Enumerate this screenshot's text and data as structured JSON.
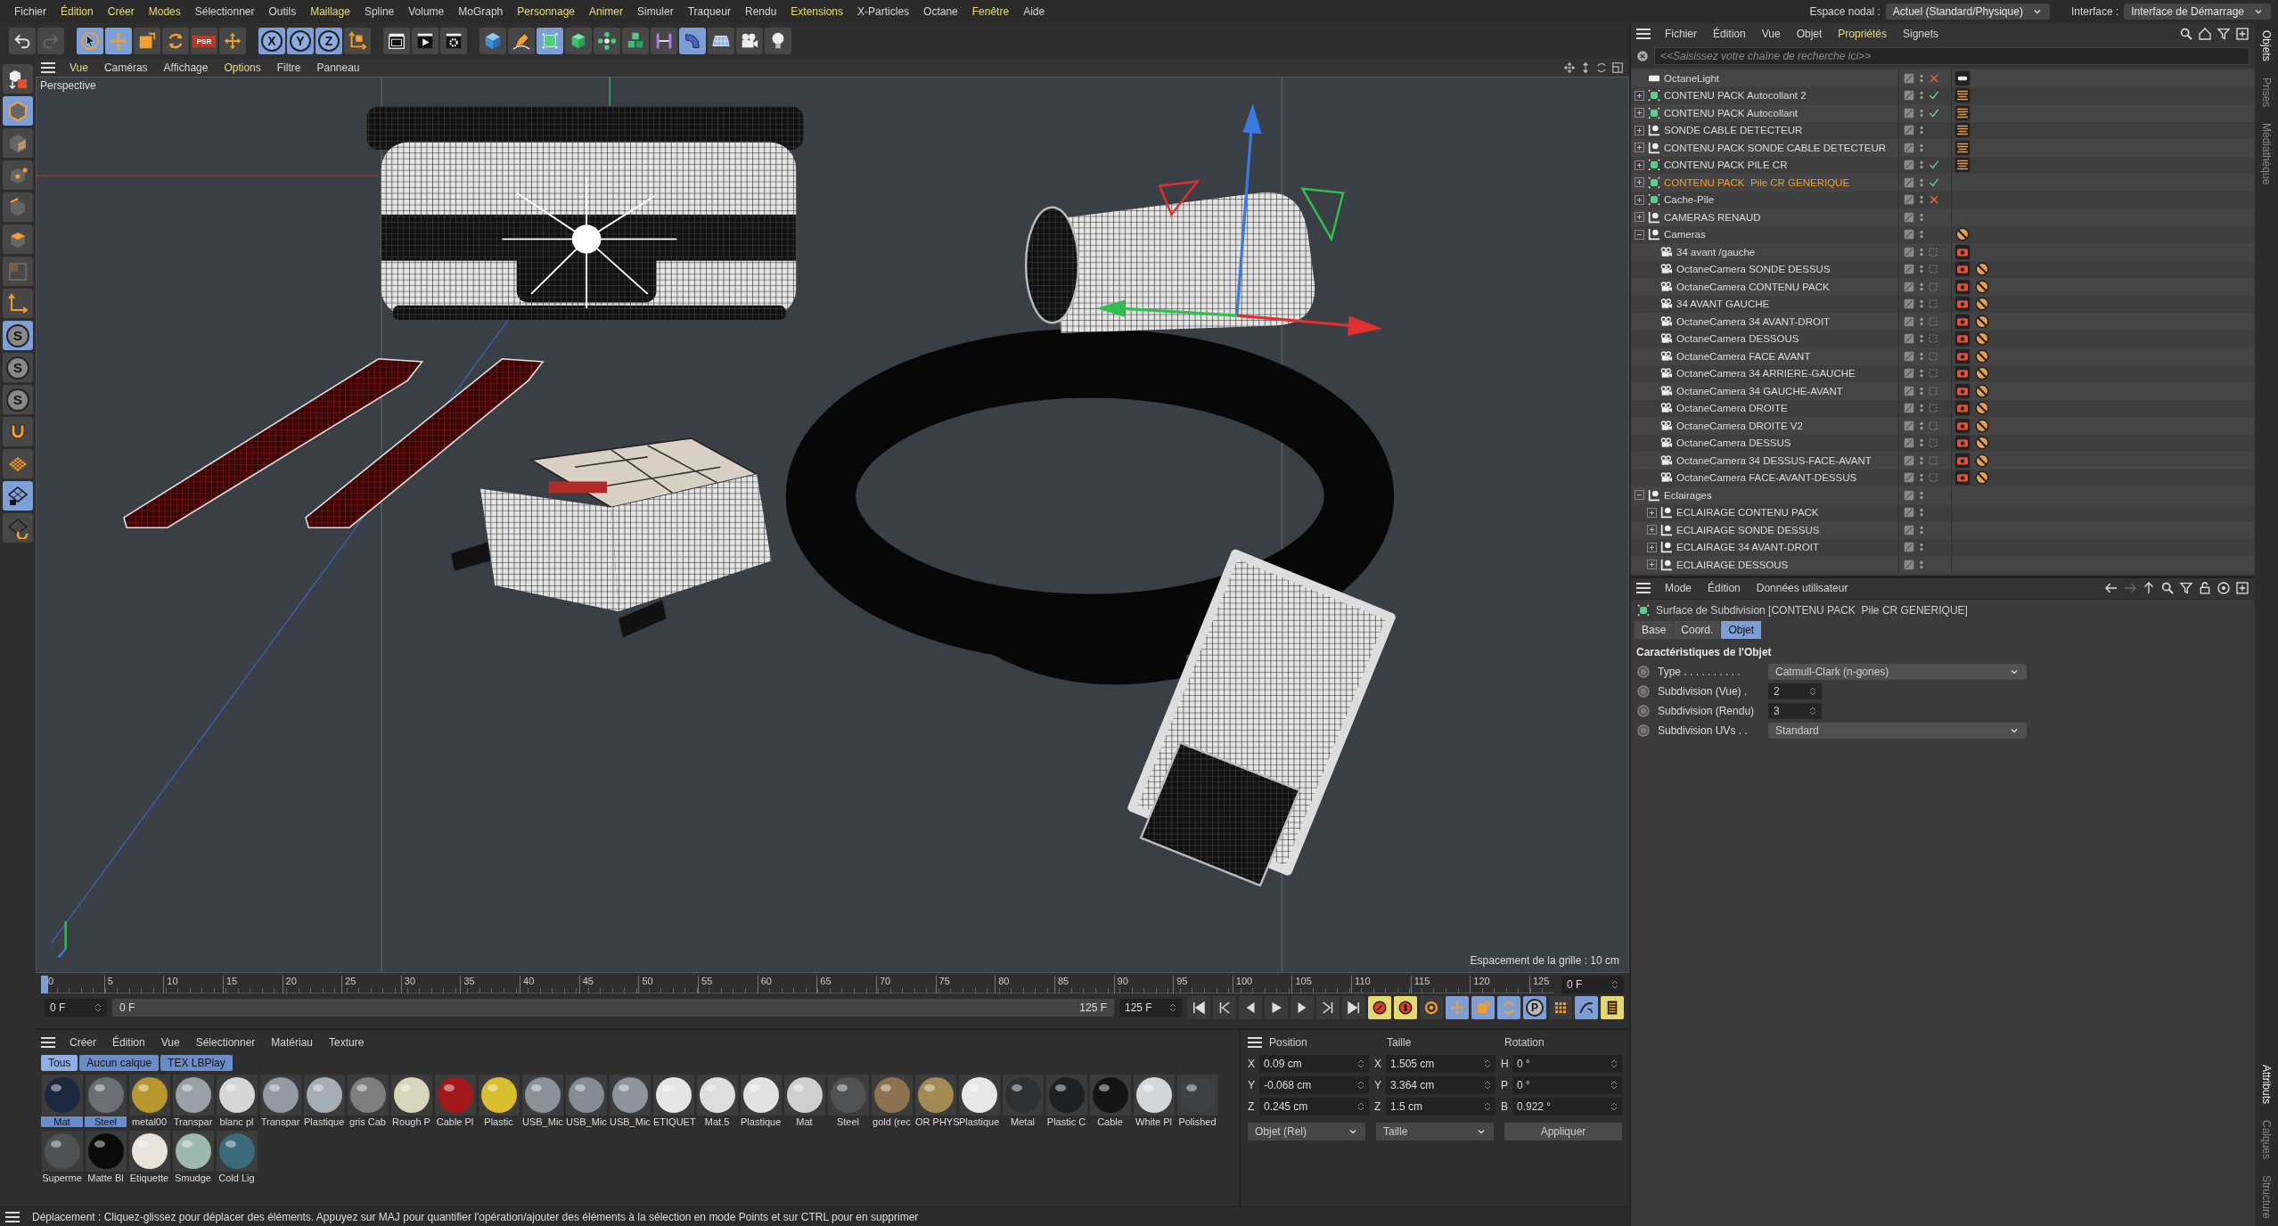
{
  "menubar": {
    "items": [
      {
        "label": "Fichier",
        "highlighted": false
      },
      {
        "label": "Édition",
        "highlighted": true
      },
      {
        "label": "Créer",
        "highlighted": true
      },
      {
        "label": "Modes",
        "highlighted": true
      },
      {
        "label": "Sélectionner",
        "highlighted": false
      },
      {
        "label": "Outils",
        "highlighted": false
      },
      {
        "label": "Maillage",
        "highlighted": true
      },
      {
        "label": "Spline",
        "highlighted": false
      },
      {
        "label": "Volume",
        "highlighted": false
      },
      {
        "label": "MoGraph",
        "highlighted": false
      },
      {
        "label": "Personnage",
        "highlighted": true
      },
      {
        "label": "Animer",
        "highlighted": true
      },
      {
        "label": "Simuler",
        "highlighted": false
      },
      {
        "label": "Traqueur",
        "highlighted": false
      },
      {
        "label": "Rendu",
        "highlighted": false
      },
      {
        "label": "Extensions",
        "highlighted": true
      },
      {
        "label": "X-Particles",
        "highlighted": false
      },
      {
        "label": "Octane",
        "highlighted": false
      },
      {
        "label": "Fenêtre",
        "highlighted": true
      },
      {
        "label": "Aide",
        "highlighted": false
      }
    ],
    "selectors": [
      {
        "label": "Espace nodal :",
        "value": "Actuel (Standard/Physique)"
      },
      {
        "label": "Interface :",
        "value": "Interface de Démarrage"
      }
    ]
  },
  "toolbar": {
    "groups": [
      {
        "items": [
          {
            "kind": "undo",
            "selected": false
          },
          {
            "kind": "redo",
            "selected": false
          }
        ]
      },
      {
        "items": [
          {
            "kind": "cursor",
            "selected": true
          },
          {
            "kind": "move",
            "selected": true
          },
          {
            "kind": "scale",
            "selected": false
          },
          {
            "kind": "rotate",
            "selected": false
          },
          {
            "kind": "psr",
            "label": "PSR",
            "selected": false
          },
          {
            "kind": "move",
            "selected": false
          }
        ]
      },
      {
        "items": [
          {
            "kind": "axis",
            "label": "X",
            "selected": true
          },
          {
            "kind": "axis",
            "label": "Y",
            "selected": true
          },
          {
            "kind": "axis",
            "label": "Z",
            "selected": true
          },
          {
            "kind": "coord",
            "selected": false
          }
        ]
      },
      {
        "items": [
          {
            "kind": "render-view",
            "selected": false
          },
          {
            "kind": "render",
            "selected": false
          },
          {
            "kind": "render-settings",
            "selected": false
          }
        ]
      },
      {
        "items": [
          {
            "kind": "cube",
            "selected": false
          },
          {
            "kind": "pen",
            "selected": false
          },
          {
            "kind": "subdivision",
            "selected": true
          },
          {
            "kind": "extrude",
            "selected": false
          },
          {
            "kind": "cloner",
            "selected": false
          },
          {
            "kind": "array",
            "selected": false
          },
          {
            "kind": "deformer",
            "selected": false
          },
          {
            "kind": "bend",
            "selected": true
          },
          {
            "kind": "floor",
            "selected": false
          },
          {
            "kind": "camera",
            "selected": false
          },
          {
            "kind": "light",
            "selected": false
          }
        ]
      }
    ]
  },
  "left_toolbar": [
    {
      "kind": "model",
      "selected": false
    },
    {
      "kind": "object",
      "selected": true
    },
    {
      "kind": "texture",
      "selected": false
    },
    {
      "kind": "points",
      "selected": false
    },
    {
      "kind": "edges",
      "selected": false
    },
    {
      "kind": "polygons",
      "selected": false
    },
    {
      "kind": "uv",
      "selected": false
    },
    {
      "kind": "axis",
      "selected": false
    },
    {
      "kind": "snap",
      "label": "S",
      "selected": true
    },
    {
      "kind": "snap",
      "label": "S",
      "selected": false
    },
    {
      "kind": "snap",
      "label": "S",
      "selected": false
    },
    {
      "kind": "magnet",
      "selected": false
    },
    {
      "kind": "workplane",
      "selected": false
    },
    {
      "kind": "workplane-lock",
      "selected": true
    },
    {
      "kind": "workplane-rotate",
      "selected": false
    }
  ],
  "viewport": {
    "menu": [
      {
        "label": "Vue",
        "highlighted": true
      },
      {
        "label": "Caméras",
        "highlighted": false
      },
      {
        "label": "Affichage",
        "highlighted": false
      },
      {
        "label": "Options",
        "highlighted": true
      },
      {
        "label": "Filtre",
        "highlighted": false
      },
      {
        "label": "Panneau",
        "highlighted": false
      }
    ],
    "camera_label": "Perspective",
    "grid_spacing": "Espacement de la grille : 10 cm"
  },
  "timeline": {
    "ticks": [
      "0",
      "5",
      "10",
      "15",
      "20",
      "25",
      "30",
      "35",
      "40",
      "45",
      "50",
      "55",
      "60",
      "65",
      "70",
      "75",
      "80",
      "85",
      "90",
      "95",
      "100",
      "105",
      "110",
      "115",
      "120",
      "125"
    ],
    "playhead": {
      "level": 0
    },
    "frame_field": "0 F",
    "start_field": "0 F",
    "range": {
      "start": "0 F",
      "end": "125 F",
      "level": 1
    },
    "end_field": "125 F",
    "param_key_label": "P"
  },
  "materials": {
    "menu": [
      "Créer",
      "Édition",
      "Vue",
      "Sélectionner",
      "Matériau",
      "Texture"
    ],
    "filters": [
      {
        "label": "Tous",
        "selected": true
      },
      {
        "label": "Aucun calque",
        "selected": false
      },
      {
        "label": "TEX LBPlay",
        "selected": false
      }
    ],
    "items": [
      {
        "label": "Mat",
        "color": "#1c2740",
        "selected": true
      },
      {
        "label": "Steel",
        "color": "#6b6e72",
        "selected": true
      },
      {
        "label": "metal00",
        "color": "#b8982e",
        "selected": false
      },
      {
        "label": "Transpar",
        "color": "#9aa0a8",
        "selected": false
      },
      {
        "label": "blanc pl",
        "color": "#d6d6d6",
        "selected": false
      },
      {
        "label": "Transpar",
        "color": "#939aa3",
        "selected": false
      },
      {
        "label": "Plastique",
        "color": "#a4acb4",
        "selected": false
      },
      {
        "label": "gris Cab",
        "color": "#7e7e7e",
        "selected": false
      },
      {
        "label": "Rough P",
        "color": "#d9d6bd",
        "selected": false
      },
      {
        "label": "Cable Pl",
        "color": "#a3181a",
        "selected": false
      },
      {
        "label": "Plastic",
        "color": "#d9be2e",
        "selected": false
      },
      {
        "label": "USB_Mic",
        "color": "#8b9199",
        "selected": false
      },
      {
        "label": "USB_Mic",
        "color": "#868c94",
        "selected": false
      },
      {
        "label": "USB_Mic",
        "color": "#8f959d",
        "selected": false
      },
      {
        "label": "ETIQUET",
        "color": "#e6e6e6",
        "selected": false
      },
      {
        "label": "Mat.5",
        "color": "#dedede",
        "selected": false
      },
      {
        "label": "Plastique",
        "color": "#e2e2e2",
        "selected": false
      },
      {
        "label": "Mat",
        "color": "#cfcfcf",
        "selected": false
      },
      {
        "label": "Steel",
        "color": "#505254",
        "selected": false
      },
      {
        "label": "gold (rec",
        "color": "#8c7250",
        "selected": false
      },
      {
        "label": "OR PHYS",
        "color": "#a38a52",
        "selected": false
      },
      {
        "label": "Plastique",
        "color": "#e8e8e8",
        "selected": false
      },
      {
        "label": "Metal",
        "color": "#2f3032",
        "selected": false
      },
      {
        "label": "Plastic C",
        "color": "#1f2022",
        "selected": false
      },
      {
        "label": "Cable",
        "color": "#141414",
        "selected": false
      },
      {
        "label": "White Pl",
        "color": "#d4d6d8",
        "selected": false
      },
      {
        "label": "Polished",
        "color": "#3e4042",
        "selected": false
      },
      {
        "label": "Superme",
        "color": "#4e5052",
        "selected": false
      },
      {
        "label": "Matte Bl",
        "color": "#0b0b0b",
        "selected": false
      },
      {
        "label": "Etiquette",
        "color": "#e8e3da",
        "selected": false
      },
      {
        "label": "Smudge",
        "color": "#9fb8b0",
        "selected": false
      },
      {
        "label": "Cold Lig",
        "color": "#3b6a7a",
        "selected": false
      }
    ]
  },
  "coordinates": {
    "headers": [
      "Position",
      "Taille",
      "Rotation"
    ],
    "rows": [
      {
        "cells": [
          {
            "axis": "X",
            "value": "0.09 cm"
          },
          {
            "axis": "X",
            "value": "1.505 cm"
          },
          {
            "axis": "H",
            "value": "0 °"
          }
        ]
      },
      {
        "cells": [
          {
            "axis": "Y",
            "value": "-0.068 cm"
          },
          {
            "axis": "Y",
            "value": "3.364 cm"
          },
          {
            "axis": "P",
            "value": "0 °"
          }
        ]
      },
      {
        "cells": [
          {
            "axis": "Z",
            "value": "0.245 cm"
          },
          {
            "axis": "Z",
            "value": "1.5 cm"
          },
          {
            "axis": "B",
            "value": "0.922 °"
          }
        ]
      }
    ],
    "dropdowns": [
      "Objet (Rel)",
      "Taille"
    ],
    "apply_button": "Appliquer"
  },
  "status_bar": "Déplacement : Cliquez-glissez pour déplacer des éléments. Appuyez sur MAJ pour quantifier l'opération/ajouter des éléments à la sélection en mode Points et sur CTRL pour en supprimer",
  "object_manager": {
    "menu": [
      {
        "label": "Fichier",
        "highlighted": false
      },
      {
        "label": "Édition",
        "highlighted": false
      },
      {
        "label": "Vue",
        "highlighted": false
      },
      {
        "label": "Objet",
        "highlighted": false
      },
      {
        "label": "Propriétés",
        "highlighted": true
      },
      {
        "label": "Signets",
        "highlighted": false
      }
    ],
    "search_placeholder": "<<Saisissez votre chaîne de recherche ici>>",
    "objects": [
      {
        "name": "OctaneLight",
        "kind": "light",
        "enabled": false,
        "tags": [
          {
            "kind": "light"
          }
        ],
        "selected": false
      },
      {
        "name": "CONTENU PACK Autocollant 2",
        "kind": "subdivision",
        "expanded": false,
        "enabled": true,
        "tags": [
          {
            "kind": "clapper"
          }
        ],
        "selected": false
      },
      {
        "name": "CONTENU PACK Autocollant",
        "kind": "subdivision",
        "expanded": false,
        "enabled": true,
        "tags": [
          {
            "kind": "clapper"
          }
        ],
        "selected": false
      },
      {
        "name": "SONDE CABLE DETECTEUR",
        "kind": "null",
        "expanded": false,
        "tags": [
          {
            "kind": "clapper"
          }
        ],
        "selected": false
      },
      {
        "name": "CONTENU PACK SONDE CABLE DETECTEUR",
        "kind": "null",
        "expanded": false,
        "tags": [
          {
            "kind": "clapper"
          }
        ],
        "selected": false
      },
      {
        "name": "CONTENU PACK PILE CR",
        "kind": "subdivision",
        "expanded": false,
        "enabled": true,
        "tags": [
          {
            "kind": "clapper"
          }
        ],
        "selected": false
      },
      {
        "name": "CONTENU PACK  Pile CR GENERIQUE",
        "kind": "subdivision",
        "expanded": false,
        "enabled": true,
        "selected": true
      },
      {
        "name": "Cache-Pile",
        "kind": "subdivision",
        "expanded": false,
        "enabled": false,
        "selected": false
      },
      {
        "name": "CAMERAS RENAUD",
        "kind": "null",
        "expanded": false,
        "selected": false
      },
      {
        "name": "Cameras",
        "kind": "null",
        "expanded": true,
        "tags": [
          {
            "kind": "no-entry"
          }
        ],
        "selected": false,
        "children": [
          {
            "name": "34 avant /gauche",
            "kind": "camera",
            "tags": [
              {
                "kind": "camera"
              }
            ],
            "selected": false
          },
          {
            "name": "OctaneCamera SONDE DESSUS",
            "kind": "camera",
            "tags": [
              {
                "kind": "camera"
              },
              {
                "kind": "no-entry"
              }
            ],
            "selected": false
          },
          {
            "name": "OctaneCamera CONTENU PACK",
            "kind": "camera",
            "tags": [
              {
                "kind": "camera"
              },
              {
                "kind": "no-entry"
              }
            ],
            "selected": false
          },
          {
            "name": "34 AVANT GAUCHE",
            "kind": "camera",
            "tags": [
              {
                "kind": "camera"
              },
              {
                "kind": "no-entry"
              }
            ],
            "selected": false
          },
          {
            "name": "OctaneCamera 34 AVANT-DROIT",
            "kind": "camera",
            "tags": [
              {
                "kind": "camera"
              },
              {
                "kind": "no-entry"
              }
            ],
            "selected": false
          },
          {
            "name": "OctaneCamera DESSOUS",
            "kind": "camera",
            "tags": [
              {
                "kind": "camera"
              },
              {
                "kind": "no-entry"
              }
            ],
            "selected": false
          },
          {
            "name": "OctaneCamera FACE AVANT",
            "kind": "camera",
            "tags": [
              {
                "kind": "camera"
              },
              {
                "kind": "no-entry"
              }
            ],
            "selected": false
          },
          {
            "name": "OctaneCamera 34 ARRIERE-GAUCHE",
            "kind": "camera",
            "tags": [
              {
                "kind": "camera"
              },
              {
                "kind": "no-entry"
              }
            ],
            "selected": false
          },
          {
            "name": "OctaneCamera 34 GAUCHE-AVANT",
            "kind": "camera",
            "tags": [
              {
                "kind": "camera"
              },
              {
                "kind": "no-entry"
              }
            ],
            "selected": false
          },
          {
            "name": "OctaneCamera DROITE",
            "kind": "camera",
            "tags": [
              {
                "kind": "camera"
              },
              {
                "kind": "no-entry"
              }
            ],
            "selected": false
          },
          {
            "name": "OctaneCamera DROITE V2",
            "kind": "camera",
            "tags": [
              {
                "kind": "camera"
              },
              {
                "kind": "no-entry"
              }
            ],
            "selected": false
          },
          {
            "name": "OctaneCamera DESSUS",
            "kind": "camera",
            "tags": [
              {
                "kind": "camera"
              },
              {
                "kind": "no-entry"
              }
            ],
            "selected": false
          },
          {
            "name": "OctaneCamera 34 DESSUS-FACE-AVANT",
            "kind": "camera",
            "tags": [
              {
                "kind": "camera"
              },
              {
                "kind": "no-entry"
              }
            ],
            "selected": false
          },
          {
            "name": "OctaneCamera FACE-AVANT-DESSUS",
            "kind": "camera",
            "tags": [
              {
                "kind": "camera"
              },
              {
                "kind": "no-entry"
              }
            ],
            "selected": false
          }
        ]
      },
      {
        "name": "Eclairages",
        "kind": "null",
        "expanded": true,
        "selected": false,
        "children": [
          {
            "name": "ECLAIRAGE CONTENU PACK",
            "kind": "null",
            "expanded": false,
            "selected": false
          },
          {
            "name": "ECLAIRAGE SONDE DESSUS",
            "kind": "null",
            "expanded": false,
            "selected": false
          },
          {
            "name": "ECLAIRAGE 34 AVANT-DROIT",
            "kind": "null",
            "expanded": false,
            "selected": false
          },
          {
            "name": "ECLAIRAGE DESSOUS",
            "kind": "null",
            "expanded": false,
            "selected": false
          }
        ]
      }
    ]
  },
  "attributes": {
    "menu": [
      "Mode",
      "Édition",
      "Données utilisateur"
    ],
    "title": "Surface de Subdivision [CONTENU PACK  Pile CR GENERIQUE]",
    "tabs": [
      {
        "label": "Base",
        "selected": false
      },
      {
        "label": "Coord.",
        "selected": false
      },
      {
        "label": "Objet",
        "selected": true
      }
    ],
    "section": "Caractéristiques de l'Objet",
    "fields": [
      {
        "kind": "dropdown",
        "label": "Type . . . . . . . . . .",
        "value": "Catmull-Clark (n-gones)"
      },
      {
        "kind": "number",
        "label": "Subdivision (Vue) .",
        "value": "2"
      },
      {
        "kind": "number",
        "label": "Subdivision (Rendu)",
        "value": "3"
      },
      {
        "kind": "dropdown",
        "label": "Subdivision UVs . .",
        "value": "Standard"
      }
    ]
  },
  "side_tabs": {
    "top": [
      {
        "label": "Objets",
        "selected": true
      },
      {
        "label": "Prises",
        "selected": false
      },
      {
        "label": "Médiathèque",
        "selected": false
      }
    ],
    "bottom": [
      {
        "label": "Attributs",
        "selected": true
      },
      {
        "label": "Calques",
        "selected": false
      },
      {
        "label": "Structure",
        "selected": false
      }
    ]
  }
}
